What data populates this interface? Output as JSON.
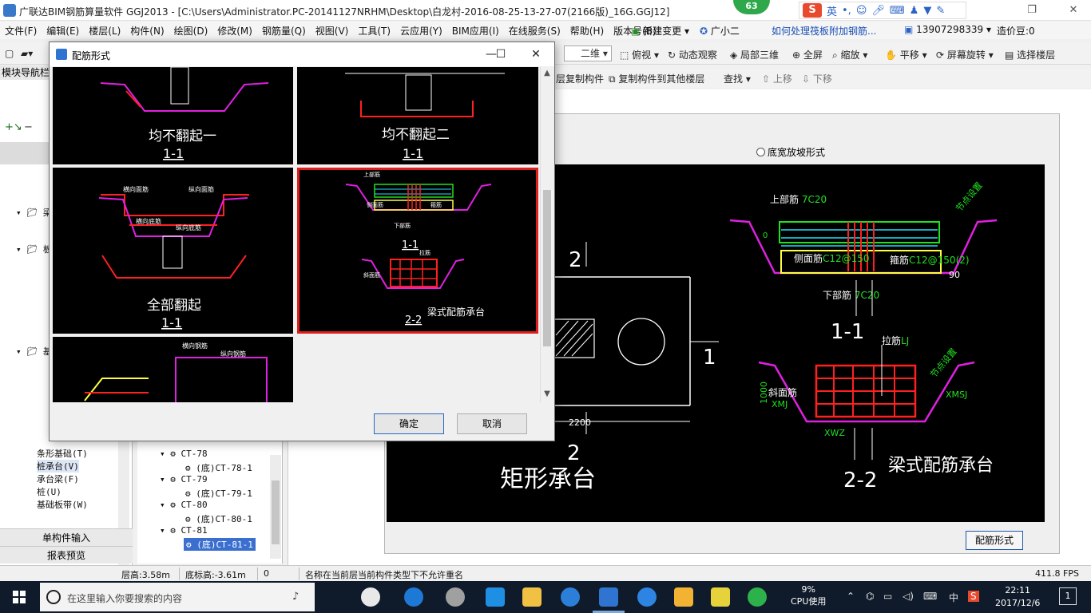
{
  "window": {
    "title": "广联达BIM钢筋算量软件 GGJ2013 - [C:\\Users\\Administrator.PC-20141127NRHM\\Desktop\\白龙村-2016-08-25-13-27-07(2166版)_16G.GGJ12]",
    "badge": "63",
    "ime_label": "英"
  },
  "menu": {
    "items": [
      "文件(F)",
      "编辑(E)",
      "楼层(L)",
      "构件(N)",
      "绘图(D)",
      "修改(M)",
      "钢筋量(Q)",
      "视图(V)",
      "工具(T)",
      "云应用(Y)",
      "BIM应用(I)",
      "在线服务(S)",
      "帮助(H)",
      "版本号(B)"
    ],
    "new_change": "新建变更",
    "guangxiaoer": "广小二",
    "help_link": "如何处理筏板附加钢筋...",
    "phone": "13907298339",
    "zaojia": "造价豆:0"
  },
  "toolbar": {
    "view_combo": "二维",
    "fushi": "俯视",
    "dongtai": "动态观察",
    "jubu": "局部三维",
    "quanping": "全屏",
    "suofang": "缩放",
    "pingyi": "平移",
    "pingmu": "屏幕旋转",
    "xuanze": "选择楼层",
    "copy_layer": "层复制构件",
    "copy_other": "复制构件到其他楼层",
    "find": "查找",
    "up": "上移",
    "down": "下移"
  },
  "left_panel": {
    "header": "模块导航栏",
    "nodes": [
      "梁",
      "板",
      "基",
      "条形基础(T)",
      "桩承台(V)",
      "承台梁(F)",
      "桩(U)",
      "基础板带(W)"
    ],
    "btn_single": "单构件输入",
    "btn_report": "报表预览"
  },
  "tree": {
    "items": [
      {
        "label": "CT-78",
        "child": "(底)CT-78-1"
      },
      {
        "label": "CT-79",
        "child": "(底)CT-79-1"
      },
      {
        "label": "CT-80",
        "child": "(底)CT-80-1"
      },
      {
        "label": "CT-81",
        "child": "(底)CT-81-1"
      }
    ]
  },
  "right_panel": {
    "radio_label": "底宽放坡形式",
    "btn_peijin": "配筋形式",
    "cad": {
      "label_2_top": "2",
      "label_1": "1",
      "label_2_bottom": "2",
      "dim_2200": "2200",
      "rect_title": "矩形承台",
      "top_bar": "上部筋",
      "top_bar_val": "7C20",
      "side_bar": "侧面筋",
      "side_bar_val": "C12@150",
      "stirrup": "箍筋",
      "stirrup_val": "C12@150(2)",
      "bottom_bar": "下部筋",
      "bottom_bar_val": "7C20",
      "section_11": "1-1",
      "tie_bar": "拉筋",
      "tie_val": "LJ",
      "slope_bar": "斜面筋",
      "slope_val": "XMJ",
      "xmsj": "XMSJ",
      "xwz": "XWZ",
      "dim_1000": "1000",
      "dim_0": "0",
      "angle_90": "90",
      "node_set": "节点设置",
      "section_22": "2-2",
      "beam_title": "梁式配筋承台"
    }
  },
  "dialog": {
    "title": "配筋形式",
    "options": [
      {
        "name": "均不翻起一",
        "section": "1-1"
      },
      {
        "name": "均不翻起二",
        "section": "1-1"
      },
      {
        "name": "全部翻起",
        "section": "1-1"
      },
      {
        "name": "梁式配筋承台",
        "section_a": "1-1",
        "section_b": "2-2"
      }
    ],
    "ok": "确定",
    "cancel": "取消",
    "small_labels": {
      "hengxiang_mian": "横向面筋",
      "zongxiang_mian": "纵向面筋",
      "hengxiang_di": "横向底筋",
      "zongxiang_di": "纵向底筋",
      "shangbu": "上部筋",
      "xiabu": "下部筋",
      "cemian": "侧面筋",
      "gujin": "箍筋",
      "lajin": "拉筋",
      "xiemian": "斜面筋",
      "hengxiang_gang": "横向钢筋",
      "zongxiang_gang": "纵向钢筋",
      "jiedian": "节点设置"
    }
  },
  "status": {
    "floor_height": "层高:3.58m",
    "base_height": "底标高:-3.61m",
    "zero": "0",
    "message": "名称在当前层当前构件类型下不允许重名",
    "fps": "411.8 FPS"
  },
  "taskbar": {
    "search_placeholder": "在这里输入你要搜索的内容",
    "cpu_percent": "9%",
    "cpu_label": "CPU使用",
    "ime_zh": "中",
    "time": "22:11",
    "date": "2017/12/6",
    "notify_count": "1"
  },
  "colors": {
    "accent": "#3b6fcf",
    "selected_border": "#e01e1e",
    "cad_bg": "#000000",
    "cad_red": "#ff2020",
    "cad_magenta": "#e020e0",
    "cad_cyan": "#20e0ff",
    "cad_yellow": "#ffff40",
    "cad_green": "#20e020"
  }
}
